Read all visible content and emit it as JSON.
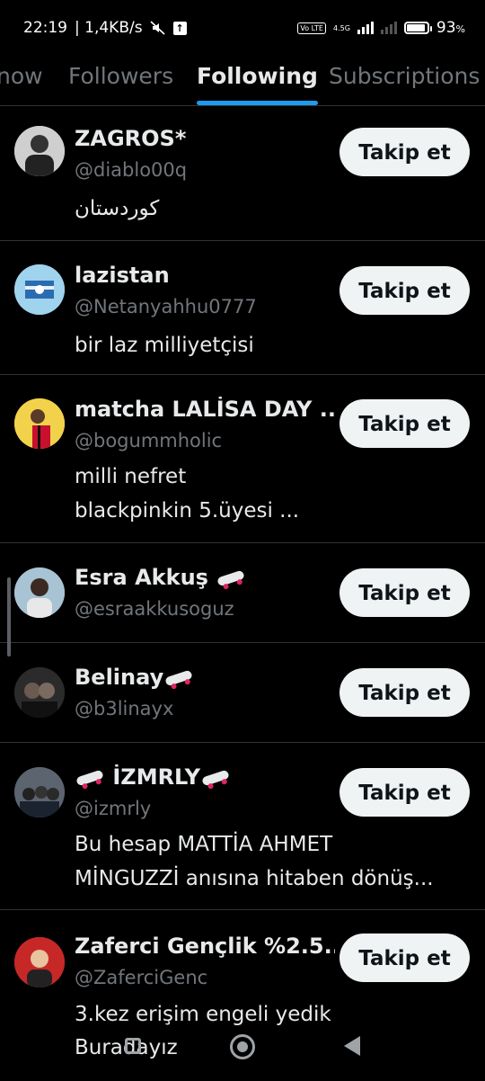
{
  "status_bar": {
    "time": "22:19",
    "speed": "| 1,4KB/s",
    "network": "4.5G",
    "volte": "Vo LTE",
    "battery_pct": "93",
    "battery_unit": "%",
    "battery_level": 0.93
  },
  "tabs": [
    {
      "label": "now"
    },
    {
      "label": "Followers"
    },
    {
      "label": "Following"
    },
    {
      "label": "Subscriptions"
    }
  ],
  "accounts": [
    {
      "name": "ZAGROS*",
      "handle": "@diablo00q",
      "bio1": "کوردستان",
      "bio2": "",
      "button": "Takip et"
    },
    {
      "name": "lazistan",
      "handle": "@Netanyahhu0777",
      "bio1": "bir laz milliyetçisi",
      "bio2": "",
      "button": "Takip et"
    },
    {
      "name": "matcha LALİSA DAY ...",
      "handle": "@bogummholic",
      "bio1": "milli nefret",
      "bio2": "blackpinkin 5.üyesi ...",
      "button": "Takip et"
    },
    {
      "name": "Esra Akkuş",
      "handle": "@esraakkusoguz",
      "bio1": "",
      "bio2": "",
      "button": "Takip et"
    },
    {
      "name": "Belinay",
      "handle": "@b3linayx",
      "bio1": "",
      "bio2": "",
      "button": "Takip et"
    },
    {
      "name": "İZMRLY",
      "handle": "@izmrly",
      "bio1": "Bu hesap MATTİA AHMET",
      "bio2": "MİNGUZZİ anısına hitaben dönüş...",
      "button": "Takip et"
    },
    {
      "name": "Zaferci Gençlik %2.5...",
      "handle": "@ZaferciGenc",
      "bio1": "3.kez erişim engeli yedik",
      "bio2": "Buradayız",
      "button": "Takip et"
    }
  ],
  "colors": {
    "accent": "#1d9bf0",
    "background": "#000000",
    "muted": "#71767b"
  }
}
